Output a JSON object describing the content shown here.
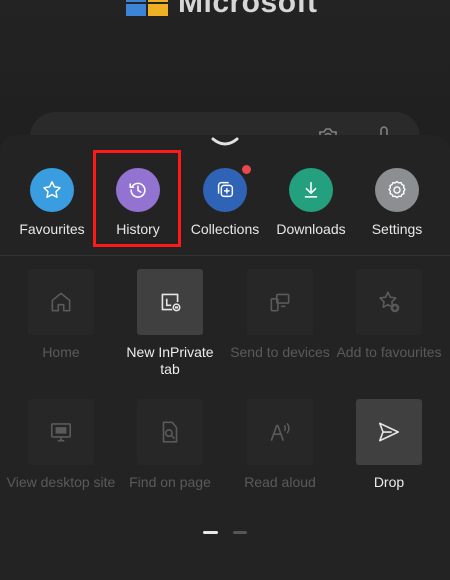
{
  "background": {
    "brand": "Microsoft",
    "colors": {
      "logo_blue": "#3c84d6",
      "logo_yellow": "#f0b024"
    }
  },
  "menu": {
    "top_row": [
      {
        "label": "Favourites",
        "icon": "star-icon",
        "color": "#3a9de0"
      },
      {
        "label": "History",
        "icon": "history-icon",
        "color": "#9373d2",
        "highlighted": true
      },
      {
        "label": "Collections",
        "icon": "collections-icon",
        "color": "#2e63b5",
        "badge": true
      },
      {
        "label": "Downloads",
        "icon": "download-icon",
        "color": "#25a07e"
      },
      {
        "label": "Settings",
        "icon": "gear-icon",
        "color": "#8c8f92"
      }
    ],
    "grid": [
      {
        "label": "Home",
        "icon": "home-icon",
        "enabled": false
      },
      {
        "label": "New InPrivate tab",
        "icon": "inprivate-tab-icon",
        "enabled": true
      },
      {
        "label": "Send to devices",
        "icon": "send-to-devices-icon",
        "enabled": false
      },
      {
        "label": "Add to favourites",
        "icon": "add-favourite-icon",
        "enabled": false
      },
      {
        "label": "View desktop site",
        "icon": "desktop-site-icon",
        "enabled": false
      },
      {
        "label": "Find on page",
        "icon": "find-on-page-icon",
        "enabled": false
      },
      {
        "label": "Read aloud",
        "icon": "read-aloud-icon",
        "enabled": false
      },
      {
        "label": "Drop",
        "icon": "send-icon",
        "enabled": true
      }
    ],
    "page_indicator": {
      "total": 2,
      "current": 1
    },
    "highlight_color": "#ff1a1a"
  }
}
